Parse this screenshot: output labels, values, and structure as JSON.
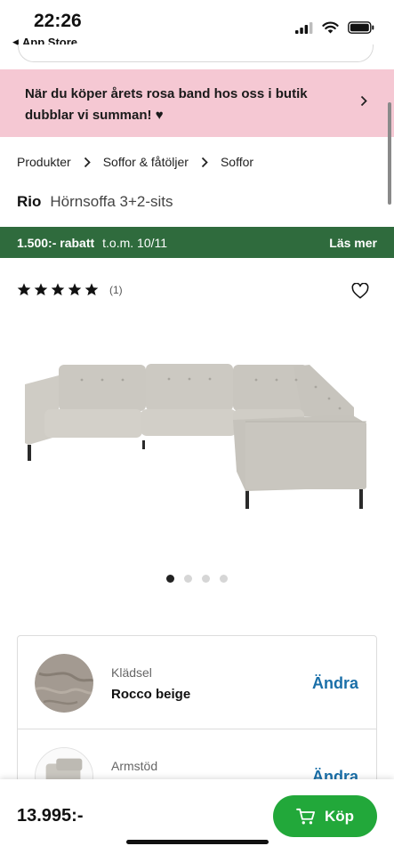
{
  "status": {
    "time": "22:26",
    "back_label": "App Store"
  },
  "promo": {
    "text": "När du köper årets rosa band hos oss i butik dubblar vi summan! ♥"
  },
  "breadcrumb": [
    "Produkter",
    "Soffor & fåtöljer",
    "Soffor"
  ],
  "product": {
    "brand": "Rio",
    "model": "Hörnsoffa 3+2-sits"
  },
  "discount": {
    "amount": "1.500:- rabatt",
    "until": "t.o.m. 10/11",
    "more": "Läs mer"
  },
  "rating": {
    "stars": 5,
    "count": "(1)"
  },
  "gallery": {
    "images": 4,
    "active_index": 0
  },
  "options": [
    {
      "label": "Klädsel",
      "value": "Rocco beige",
      "action": "Ändra",
      "icon": "fabric-swatch"
    },
    {
      "label": "Armstöd",
      "value": "",
      "action": "Ändra",
      "icon": "armrest-thumbnail"
    }
  ],
  "purchase": {
    "price": "13.995:-",
    "buy_label": "Köp"
  },
  "colors": {
    "promo_bg": "#f5c8d3",
    "discount_bg": "#2f6b3d",
    "buy_green": "#22a83a",
    "link_blue": "#1a6fa8"
  }
}
